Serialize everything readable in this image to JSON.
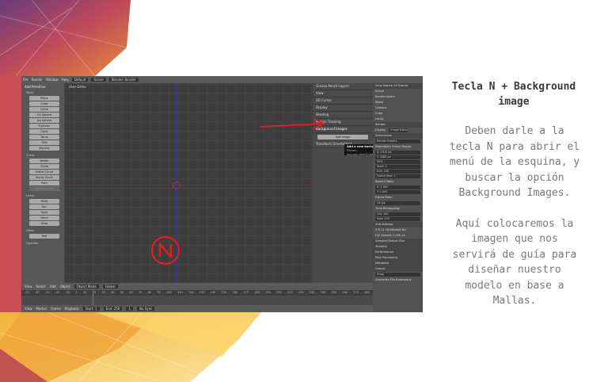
{
  "slide": {
    "title": "Tecla N + Background image",
    "paragraphs": [
      "Deben darle a la tecla N para abrir el menú de la esquina, y buscar la opción Background Images.",
      "Aquí colocaremos la imagen que nos servirá de guía para diseñar nuestro modelo en base a Mallas."
    ]
  },
  "blender": {
    "topbar": [
      "File",
      "Render",
      "Window",
      "Help"
    ],
    "topbar_fields": [
      "Default",
      "Scene",
      "Blender Render"
    ],
    "toolshelf": {
      "header": "Add Primitive",
      "mesh_label": "Mesh:",
      "mesh_items": [
        "Plane",
        "Cube",
        "Circle",
        "UV Sphere",
        "Ico Sphere",
        "Cylinder",
        "Cone",
        "Torus",
        "Grid",
        "Monkey"
      ],
      "curve_label": "Curve:",
      "curve_items": [
        "Bezier",
        "Circle",
        "Nurbs Curve",
        "Nurbs Circle",
        "Path"
      ],
      "curve_disabled": "Bezier Curve",
      "lamp_label": "Lamp:",
      "lamp_items": [
        "Point",
        "Sun",
        "Spot",
        "Hemi",
        "Area"
      ],
      "other_label": "Other:",
      "other_items": [
        "Text"
      ],
      "operator": "Operator"
    },
    "viewport_label": "User Ortho",
    "npanel": {
      "rows": [
        "Grease Pencil Layers",
        "View",
        "3D Cursor",
        "Display",
        "Shading",
        "Motion Tracking",
        "Background Images"
      ],
      "add_image": "Add Image",
      "transform": "Transform Orientations"
    },
    "tooltip": {
      "line1": "Add a new background image",
      "line2": "Python: bpy.ops.view3d.background_image_add()"
    },
    "properties": {
      "tabs": [
        "View",
        "Search",
        "All Scenes"
      ],
      "outliner": [
        "Scene",
        "RenderLayers",
        "World",
        "Camera",
        "Cube",
        "Lamp"
      ],
      "render_rows": [
        "Render",
        "Dimensions",
        "Render Presets"
      ],
      "resolution_label": "Resolution:",
      "frame_range_label": "Frame Range:",
      "resolution_values": [
        "X: 1920 px",
        "Y: 1080 px",
        "50%"
      ],
      "frame_values": [
        "Start: 1",
        "End: 250",
        "Frame Step: 1"
      ],
      "aspect_label": "Aspect Ratio:",
      "frame_rate_label": "Frame Rate:",
      "aspect_values": [
        "X: 1.000",
        "Y: 1.000"
      ],
      "fps": "24 fps",
      "time_remap": "Time Remapping:",
      "remap_values": [
        "Old: 100",
        "New: 100"
      ],
      "display_label": "Display",
      "display_value": "Image Editor",
      "sections": [
        "Anti-Aliasing",
        "Sampled Motion Blur",
        "Shading",
        "Performance",
        "Post Processing",
        "Metadata",
        "Output"
      ],
      "aa_values": [
        "5",
        "8",
        "11",
        "16"
      ],
      "filter": "Mitchell-Ne",
      "full_sample": "Full Sample",
      "size": "1.000 px",
      "output_path": "/tmp/",
      "overwrite": "Overwrite",
      "file_ext": "File Extensions"
    },
    "vpheader": [
      "View",
      "Select",
      "Add",
      "Object",
      "Object Mode",
      "Global"
    ],
    "ruler": [
      "-50",
      "-40",
      "-30",
      "-20",
      "-10",
      "0",
      "10",
      "20",
      "30",
      "40",
      "50",
      "60",
      "70",
      "80",
      "90",
      "100",
      "110",
      "120",
      "130",
      "140",
      "150",
      "160",
      "170",
      "180",
      "190",
      "200",
      "210",
      "220",
      "230",
      "240",
      "250",
      "260",
      "270",
      "280"
    ],
    "tlfoot": [
      "View",
      "Marker",
      "Frame",
      "Playback",
      "Start:",
      "1",
      "End:",
      "250",
      "1",
      "No Sync"
    ]
  },
  "colors": {
    "annotation_red": "#e01f1f",
    "title_text": "#3a3a3a",
    "body_text": "#7a7a7a"
  }
}
